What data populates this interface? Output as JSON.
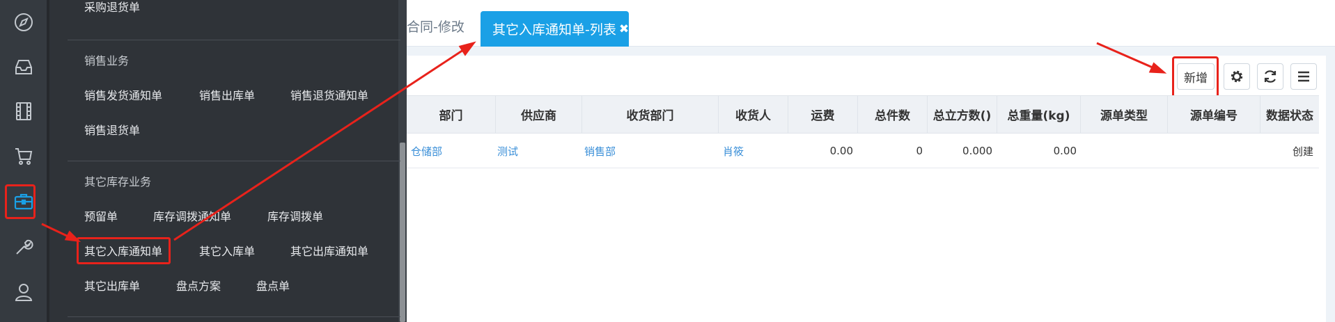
{
  "rail": {
    "icons": [
      "compass-icon",
      "inbox-icon",
      "film-icon",
      "cart-icon",
      "toolbox-icon",
      "wrench-icon",
      "user-icon"
    ],
    "active_index": 4,
    "colors": {
      "bg": "#353a40",
      "icon": "#c3c8ce",
      "active": "#1aa0e6",
      "highlight": "#e8221b"
    }
  },
  "flyout": {
    "top_cut_item": "采购退货单",
    "sales": {
      "heading": "销售业务",
      "items": [
        "销售发货通知单",
        "销售出库单",
        "销售退货通知单",
        "销售退货单"
      ]
    },
    "other": {
      "heading": "其它库存业务",
      "items": [
        "预留单",
        "库存调拨通知单",
        "库存调拨单",
        "其它入库通知单",
        "其它入库单",
        "其它出库通知单",
        "其它出库单",
        "盘点方案",
        "盘点单"
      ]
    }
  },
  "tabs": {
    "previous": "合同-修改",
    "active": "其它入库通知单-列表",
    "close_glyph": "✖"
  },
  "toolbar": {
    "add_label": "新增",
    "icons": [
      "gear-icon",
      "refresh-icon",
      "list-menu-icon"
    ]
  },
  "table": {
    "columns": [
      "部门",
      "供应商",
      "收货部门",
      "收货人",
      "运费",
      "总件数",
      "总立方数()",
      "总重量(kg)",
      "源单类型",
      "源单编号",
      "数据状态"
    ],
    "rows": [
      {
        "dept": "仓储部",
        "supplier": "测试",
        "recv_dept": "销售部",
        "receiver": "肖筱",
        "freight": "0.00",
        "pieces": "0",
        "volume": "0.000",
        "weight": "0.00",
        "src_type": "",
        "src_no": "",
        "status": "创建"
      }
    ]
  }
}
